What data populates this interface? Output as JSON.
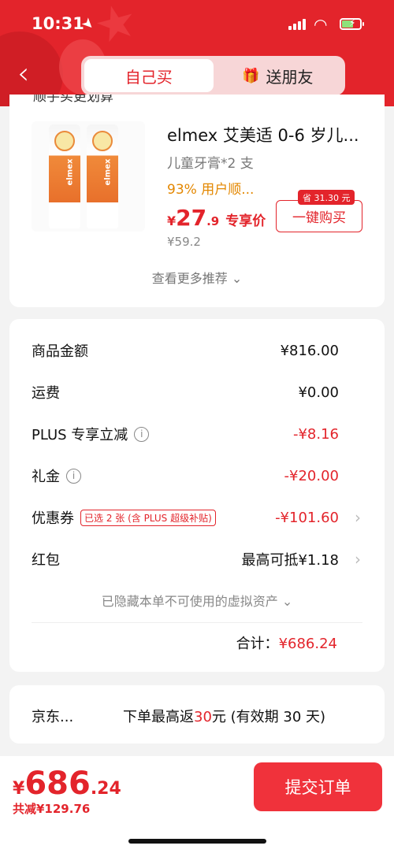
{
  "status": {
    "time": "10:31"
  },
  "header": {
    "tabs": [
      {
        "label": "自己买",
        "active": true
      },
      {
        "label": "送朋友",
        "active": false
      }
    ]
  },
  "recommend": {
    "peek_title": "顺手买更划算",
    "product": {
      "title": "elmex 艾美适 0-6 岁儿...",
      "subtitle": "儿童牙膏*2 支",
      "promo": "93% 用户顺...",
      "price_currency": "¥",
      "price_int": "27",
      "price_dec": ".9",
      "price_tag": "专享价",
      "original_price": "¥59.2",
      "save_badge": "省 31.30 元",
      "buy_label": "一键购买",
      "brand": "elmex"
    },
    "more_label": "查看更多推荐 ⌄"
  },
  "summary": {
    "rows": [
      {
        "label": "商品金额",
        "value": "¥816.00"
      },
      {
        "label": "运费",
        "value": "¥0.00"
      },
      {
        "label": "PLUS 专享立减",
        "value": "-¥8.16"
      },
      {
        "label": "礼金",
        "value": "-¥20.00"
      },
      {
        "label": "优惠券",
        "tag": "已选 2 张 (含 PLUS 超级补贴)",
        "value": "-¥101.60"
      },
      {
        "label": "红包",
        "value": "最高可抵¥1.18"
      }
    ],
    "hidden_assets": "已隐藏本单不可使用的虚拟资产 ⌄",
    "total_label": "合计：",
    "total_value": "¥686.24"
  },
  "rebate": {
    "name": "京东...",
    "text_prefix": "下单最高返",
    "text_amount": "30",
    "text_suffix": "元 (有效期 30 天)"
  },
  "bottom": {
    "currency": "¥",
    "amount_int": "686",
    "amount_dec": ".24",
    "saved": "共减¥129.76",
    "submit_label": "提交订单"
  },
  "colors": {
    "accent": "#e3242b",
    "promo": "#e38700"
  }
}
